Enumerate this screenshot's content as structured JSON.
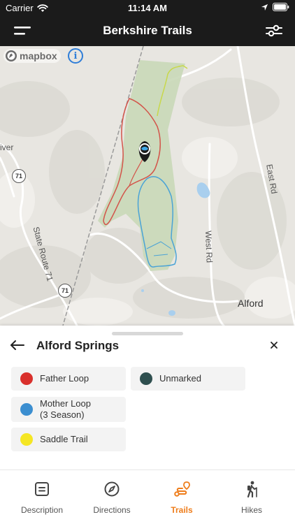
{
  "status_bar": {
    "carrier": "Carrier",
    "time": "11:14 AM"
  },
  "header": {
    "title": "Berkshire Trails"
  },
  "map": {
    "attribution": "mapbox",
    "info_symbol": "i",
    "labels": {
      "river": "iver",
      "state_route": "State Route 71",
      "west_rd": "West Rd",
      "east_rd": "East Rd",
      "town": "Alford"
    },
    "route_shield": "71",
    "colors": {
      "father_trail": "#d3544a",
      "mother_trail": "#4aa3d6",
      "saddle_trail": "#c8d84a",
      "preserve_fill": "#c9d8b8"
    }
  },
  "trail_panel": {
    "title": "Alford Springs",
    "legend": [
      {
        "label": "Father Loop",
        "color": "#d9302c"
      },
      {
        "label": "Unmarked",
        "color": "#2f4f4f"
      },
      {
        "label": "Mother Loop\n(3 Season)",
        "color": "#3b8ed0"
      },
      {
        "label": "Saddle Trail",
        "color": "#f5e623"
      }
    ]
  },
  "tabs": [
    {
      "label": "Description",
      "icon": "description-icon",
      "active": false
    },
    {
      "label": "Directions",
      "icon": "compass-icon",
      "active": false
    },
    {
      "label": "Trails",
      "icon": "route-icon",
      "active": true
    },
    {
      "label": "Hikes",
      "icon": "hiker-icon",
      "active": false
    }
  ],
  "accent_color": "#ee7d1b"
}
